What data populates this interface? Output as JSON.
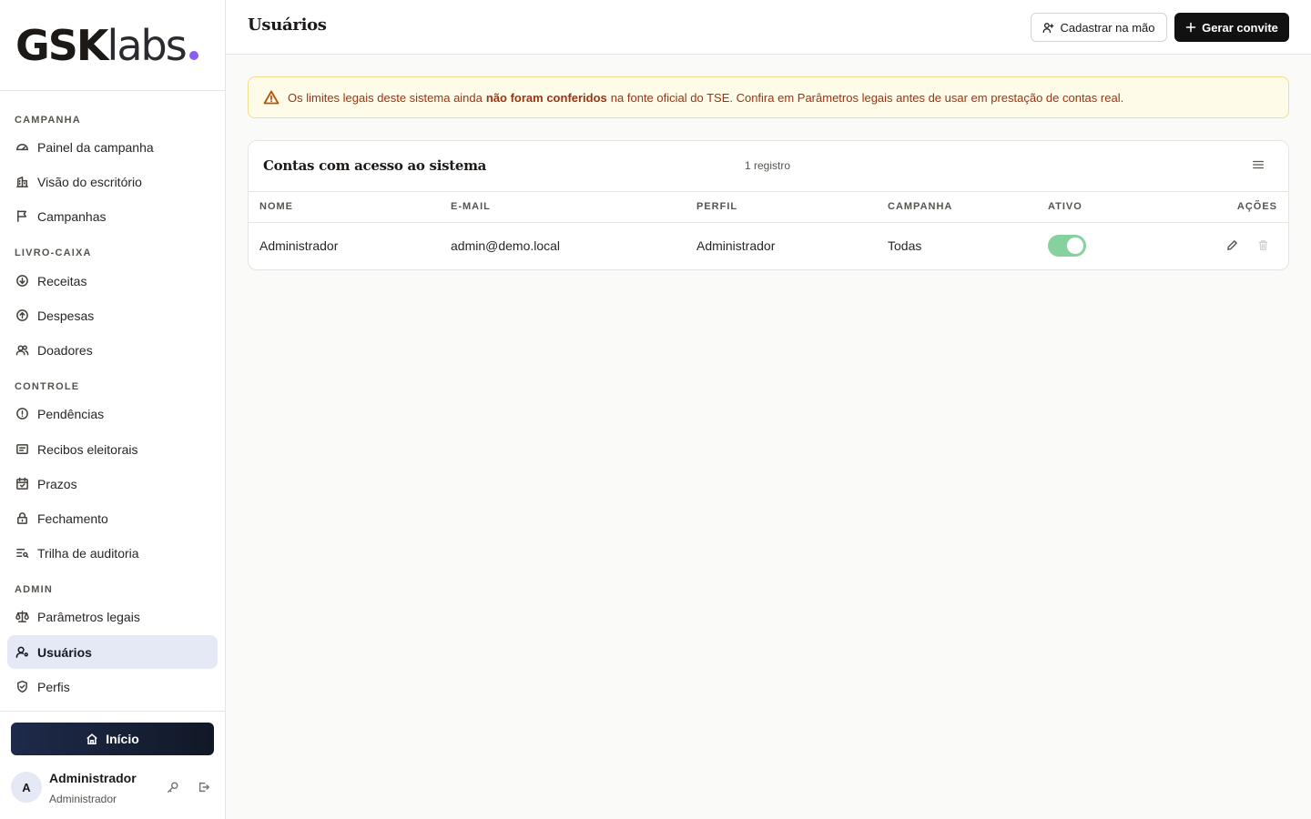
{
  "brand": {
    "bold": "GSK",
    "light": "labs",
    "dot_color": "#8b5cf6"
  },
  "sidebar": {
    "sections": [
      {
        "label": "CAMPANHA"
      },
      {
        "label": "LIVRO-CAIXA"
      },
      {
        "label": "CONTROLE"
      },
      {
        "label": "ADMIN"
      }
    ],
    "items": [
      {
        "label": "Painel da campanha",
        "icon": "gauge-icon"
      },
      {
        "label": "Visão do escritório",
        "icon": "building-icon"
      },
      {
        "label": "Campanhas",
        "icon": "flag-icon"
      },
      {
        "label": "Receitas",
        "icon": "arrow-down-circle-icon"
      },
      {
        "label": "Despesas",
        "icon": "arrow-up-circle-icon"
      },
      {
        "label": "Doadores",
        "icon": "users-icon"
      },
      {
        "label": "Pendências",
        "icon": "alert-circle-icon"
      },
      {
        "label": "Recibos eleitorais",
        "icon": "receipt-icon"
      },
      {
        "label": "Prazos",
        "icon": "calendar-check-icon"
      },
      {
        "label": "Fechamento",
        "icon": "lock-icon"
      },
      {
        "label": "Trilha de auditoria",
        "icon": "list-search-icon"
      },
      {
        "label": "Parâmetros legais",
        "icon": "scale-icon"
      },
      {
        "label": "Usuários",
        "icon": "user-cog-icon",
        "active": true
      },
      {
        "label": "Perfis",
        "icon": "shield-check-icon"
      }
    ],
    "home_label": "Início",
    "user": {
      "initial": "A",
      "name": "Administrador",
      "role": "Administrador"
    }
  },
  "header": {
    "title": "Usuários",
    "manual_button": "Cadastrar na mão",
    "invite_button": "Gerar convite"
  },
  "alert": {
    "before": "Os limites legais deste sistema ainda",
    "bold": "não foram conferidos",
    "after": "na fonte oficial do TSE. Confira em Parâmetros legais antes de usar em prestação de contas real."
  },
  "table": {
    "title": "Contas com acesso ao sistema",
    "count": "1 registro",
    "columns": [
      "NOME",
      "E-MAIL",
      "PERFIL",
      "CAMPANHA",
      "ATIVO",
      "AÇÕES"
    ],
    "rows": [
      {
        "nome": "Administrador",
        "email": "admin@demo.local",
        "perfil": "Administrador",
        "campanha": "Todas",
        "ativo": true
      }
    ]
  },
  "colors": {
    "accent": "#111827",
    "toggle_on": "#86d29f",
    "alert_bg": "#fefbe8",
    "alert_text": "#9a3412"
  }
}
